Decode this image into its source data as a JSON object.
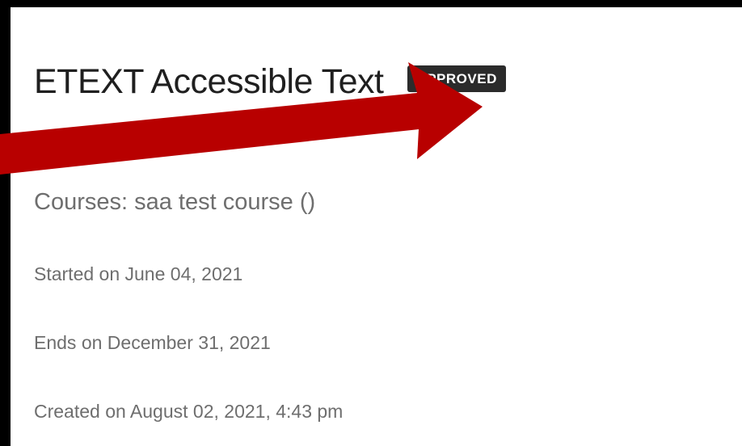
{
  "item": {
    "title": "ETEXT Accessible Text",
    "status_badge": "APPROVED"
  },
  "meta": {
    "courses": "Courses: saa test course ()",
    "started": "Started on June 04, 2021",
    "ends": "Ends on December 31, 2021",
    "created": "Created on August 02, 2021, 4:43 pm"
  },
  "colors": {
    "arrow": "#b80000",
    "badge_background": "#2b2b2b",
    "frame": "#000000"
  },
  "annotation": {
    "icon": "arrow-icon"
  }
}
